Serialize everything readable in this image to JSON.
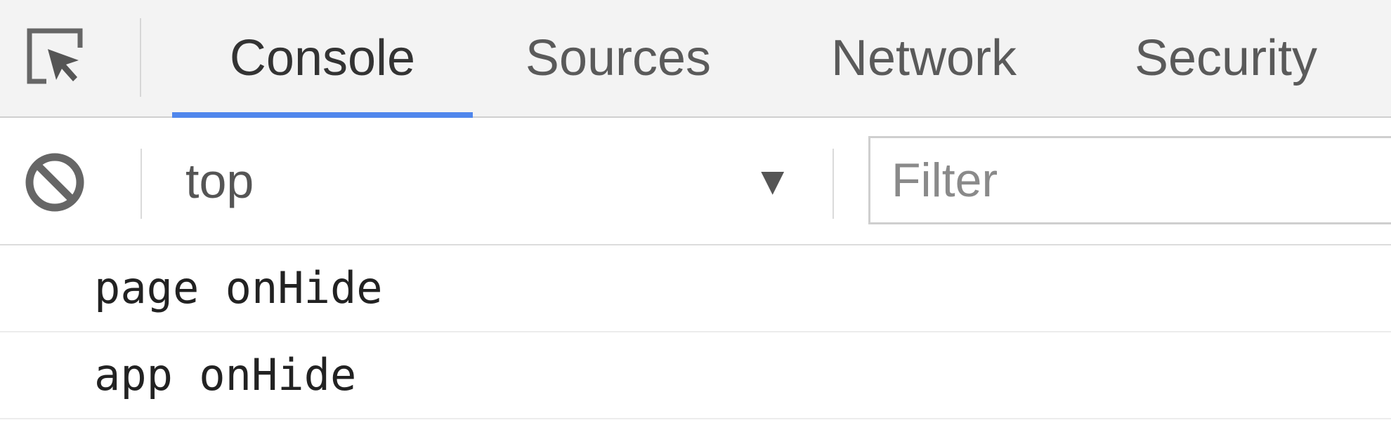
{
  "tabs": [
    {
      "label": "Console",
      "active": true
    },
    {
      "label": "Sources",
      "active": false
    },
    {
      "label": "Network",
      "active": false
    },
    {
      "label": "Security",
      "active": false
    }
  ],
  "toolbar": {
    "context": "top",
    "filter_placeholder": "Filter",
    "filter_value": ""
  },
  "messages": [
    {
      "text": "page onHide"
    },
    {
      "text": "app onHide"
    }
  ],
  "icons": {
    "inspect": "inspect-element-icon",
    "clear": "clear-console-icon",
    "dropdown": "dropdown-arrow-icon"
  },
  "colors": {
    "active_tab_underline": "#4f86ec",
    "tabbar_bg": "#f3f3f3"
  }
}
